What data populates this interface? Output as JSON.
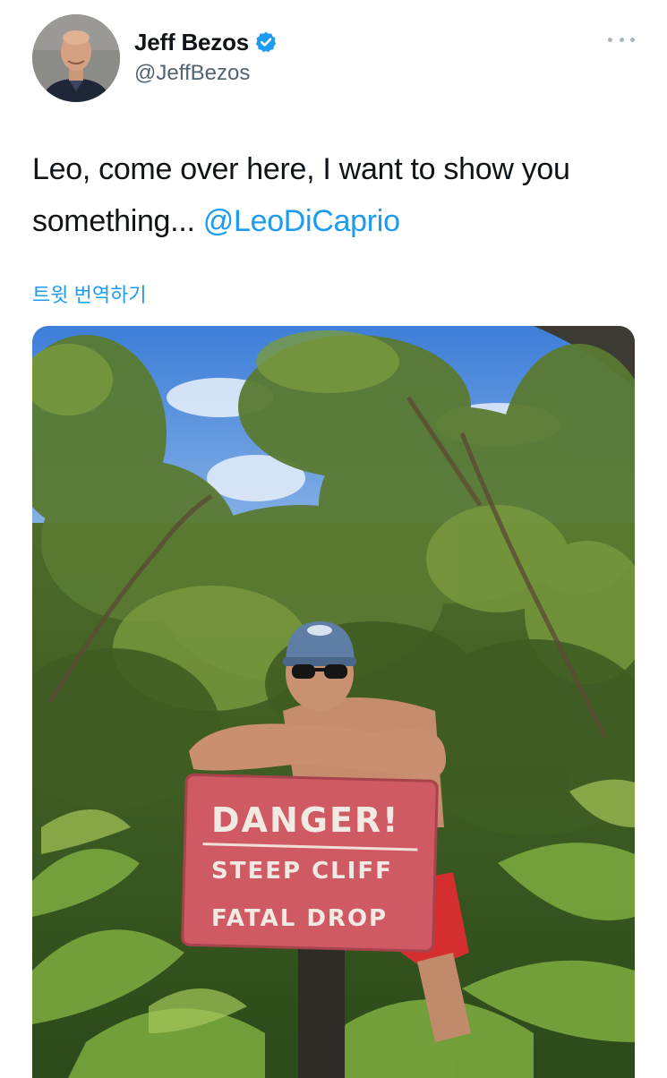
{
  "author": {
    "display_name": "Jeff Bezos",
    "handle": "@JeffBezos",
    "verified": true,
    "avatar_icon": "profile-photo"
  },
  "tweet": {
    "text_before": "Leo, come over here, I want to show you something... ",
    "mention": "@LeoDiCaprio",
    "translate_label": "트윗 번역하기"
  },
  "media": {
    "sign": {
      "line1": "DANGER!",
      "line2": "STEEP CLIFF",
      "line3": "FATAL DROP"
    }
  },
  "colors": {
    "link": "#1d9bf0",
    "verified_badge": "#1d9bf0",
    "handle_gray": "#536471"
  },
  "icons": {
    "more": "more-horizontal-icon",
    "verified": "verified-badge-icon"
  }
}
